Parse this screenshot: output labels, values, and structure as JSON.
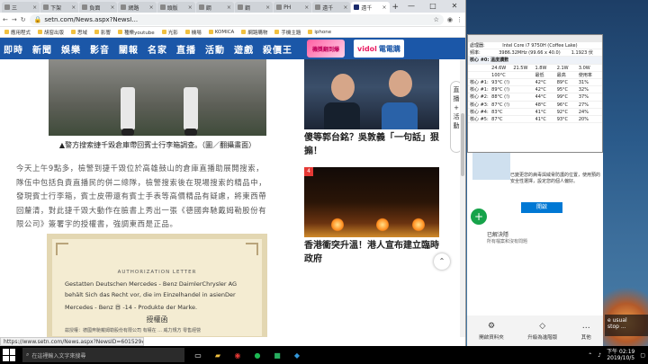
{
  "browser": {
    "tabs": [
      {
        "label": "三"
      },
      {
        "label": "下架"
      },
      {
        "label": "負面"
      },
      {
        "label": "網路"
      },
      {
        "label": "頭版"
      },
      {
        "label": "鋼"
      },
      {
        "label": "鋼"
      },
      {
        "label": "PH"
      },
      {
        "label": "遠千"
      },
      {
        "label": "遠千"
      },
      {
        "label": "遠千"
      }
    ],
    "active_tab_index": 10,
    "new_tab": "+",
    "window_controls": {
      "minimize": "—",
      "maximize": "□",
      "close": "✕"
    },
    "url": "setn.com/News.aspx?NewsI...",
    "bookmarks": [
      "應用程式",
      "胡窗出版",
      "思域",
      "影響",
      "種樂youtube",
      "光影",
      "機場",
      "KOMICA",
      "網路購物",
      "手機主題",
      "iphone"
    ],
    "status_url": "https://www.setn.com/News.aspx?NewsID=601529#"
  },
  "site_nav": {
    "items": [
      "即時",
      "新聞",
      "娛樂",
      "影音",
      "關報",
      "名家",
      "直播",
      "活動",
      "遊戲",
      "殺價王"
    ],
    "promo1": "機獎翻到爆",
    "promo2_prefix": "vidol",
    "promo2_label": "電電購"
  },
  "article": {
    "caption": "▲警方搜索捷千毀倉庫帶回賓士行李箱調查。（圖／翻攝畫面）",
    "paragraph": "今天上午9點多，檢警到捷千毀位於高雄鼓山的倉庫直播助展開搜索，隊伍中包括負責直播民的併二總隊，檢警搜索後在現場搜索的精品中，發現賓士行李箱，賓士皮帶還有賓士手表等高價精品有疑慮，將東西帶回釐清，對此捷千毀大動作在臉書上秀出一張《德國奔馳戴姆勒股份有限公司》簽署字的授權書，強調東西是正品。",
    "letter": {
      "heading": "AUTHORIZATION LETTER",
      "line1": "Gestatten Deutschen Mercedes - Benz DaimlerChrysler AG",
      "line2": "behält Sich das Recht vor, die im Einzelhandel in asienDer",
      "line3": "Mercedes - Benz  ㊃  -14 - Produkte der Marke.",
      "line4": "授權函",
      "line5": "茲授權：德國奔馳戴姆勒股份有限公司 有權在 ... 威力規方  零售經營"
    }
  },
  "sidebar": {
    "cards": [
      {
        "num": "",
        "title": "傻等郭台銘？吳敦義「一句話」狠搧！"
      },
      {
        "num": "4",
        "title": "香港衝突升溫！港人宣布建立臨時政府"
      }
    ],
    "vertical_tab": [
      "直",
      "播",
      "+",
      "活",
      "動"
    ],
    "scroll_top": "⌃"
  },
  "hwinfo": {
    "title": "",
    "rows": [
      [
        "處理器:",
        "Intel Core i7 9750H (Coffee Lake)"
      ],
      [
        "頻率:",
        "3986.32MHz (99.66 x 40.0)",
        "1.1923 伏"
      ],
      [
        "核心 #0: 溫度讀數",
        ""
      ],
      [
        "",
        "24.6W",
        "21.5W",
        "1.8W",
        "2.1W",
        "3.0W"
      ],
      [
        "",
        "100°C",
        "",
        "最低",
        "最高",
        "使用率"
      ],
      [
        "核心 #1:",
        "93°C (!)",
        "",
        "42°C",
        "89°C",
        "31%"
      ],
      [
        "核心 #1:",
        "89°C (!)",
        "",
        "42°C",
        "95°C",
        "32%"
      ],
      [
        "核心 #2:",
        "88°C (!)",
        "",
        "44°C",
        "99°C",
        "37%"
      ],
      [
        "核心 #3:",
        "87°C (!)",
        "",
        "48°C",
        "96°C",
        "27%"
      ],
      [
        "核心 #4:",
        "83°C",
        "",
        "41°C",
        "92°C",
        "24%"
      ],
      [
        "核心 #5:",
        "87°C",
        "",
        "41°C",
        "93°C",
        "20%"
      ]
    ]
  },
  "security": {
    "text1": "已變更您的病毒與威脅防護的位置，使用預的安全性選擇，設定您的個人偏好。",
    "button": "開啟",
    "dim1": "已解決隱",
    "dim2": "所有檔案和沒有問題",
    "bottom": [
      {
        "icon": "settings-icon",
        "label": "開啟資料夾"
      },
      {
        "icon": "diamond-icon",
        "label": "升級為進階版"
      },
      {
        "icon": "more-icon",
        "label": "其他"
      }
    ]
  },
  "notification": {
    "line1": "e usual",
    "line2": "stop ..."
  },
  "taskbar": {
    "search_placeholder": "在這裡輸入文字來搜尋",
    "time": "下午 02:19",
    "date": "2019/10/5"
  },
  "colors": {
    "site_nav": "#1b57a8",
    "accent_red": "#e53935",
    "taskbar": "#000000"
  }
}
